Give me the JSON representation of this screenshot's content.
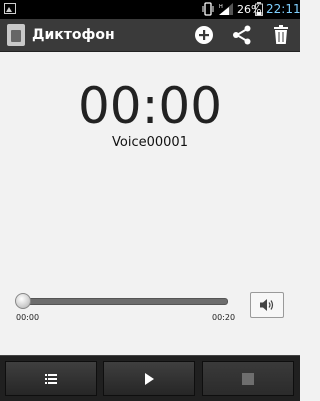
{
  "status_bar": {
    "battery_percent": "26%",
    "time": "22:11",
    "signal_bars": 3,
    "time_color": "#7fd0ff"
  },
  "action_bar": {
    "title": "Диктофон",
    "icons": [
      "app-recorder-icon",
      "add-icon",
      "share-icon",
      "delete-icon"
    ]
  },
  "recorder": {
    "timer": "00:00",
    "file_name": "Voice00001",
    "position_start": "00:00",
    "duration": "00:20",
    "progress_fraction": 0
  },
  "bottom_bar": {
    "buttons": [
      "list-icon",
      "play-icon",
      "stop-icon"
    ]
  }
}
